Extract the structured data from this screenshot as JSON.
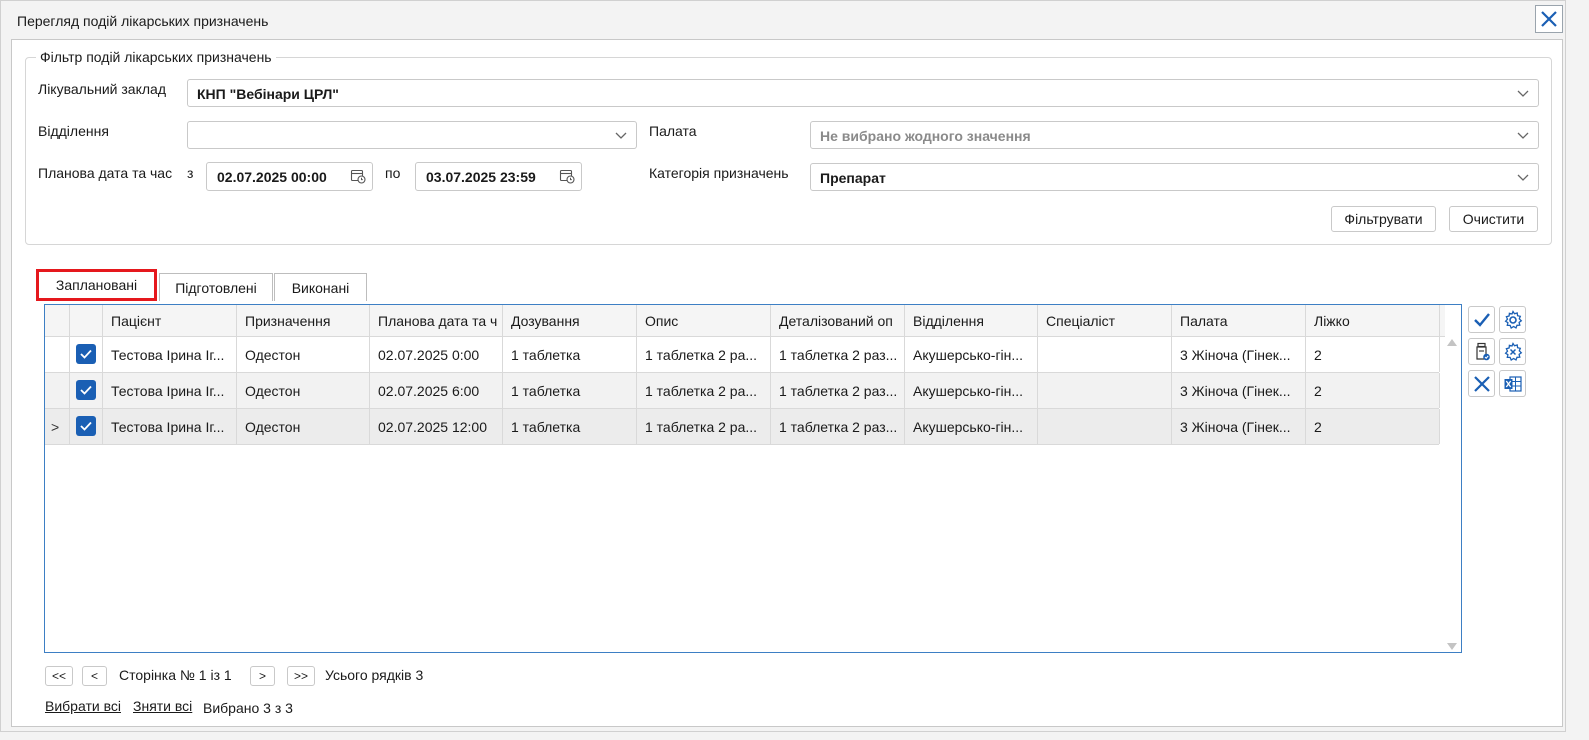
{
  "window": {
    "title": "Перегляд подій лікарських призначень"
  },
  "filter": {
    "legend": "Фільтр подій лікарських призначень",
    "facility_label": "Лікувальний заклад",
    "facility_value": "КНП \"Вебінари ЦРЛ\"",
    "department_label": "Відділення",
    "department_value": "",
    "ward_label": "Палата",
    "ward_placeholder": "Не вибрано жодного значення",
    "date_label": "Планова дата та час",
    "from_label": "з",
    "date_from": "02.07.2025 00:00",
    "to_label": "по",
    "date_to": "03.07.2025 23:59",
    "category_label": "Категорія призначень",
    "category_value": "Препарат",
    "filter_button": "Фільтрувати",
    "clear_button": "Очистити"
  },
  "tabs": [
    {
      "label": "Заплановані",
      "active": true
    },
    {
      "label": "Підготовлені",
      "active": false
    },
    {
      "label": "Виконані",
      "active": false
    }
  ],
  "grid": {
    "columns": [
      "Пацієнт",
      "Призначення",
      "Планова дата та ч",
      "Дозування",
      "Опис",
      "Деталізований оп",
      "Відділення",
      "Спеціаліст",
      "Палата",
      "Ліжко"
    ],
    "rows": [
      {
        "patient": "Тестова Ірина Іг...",
        "prescription": "Одестон",
        "date": "02.07.2025 0:00",
        "dosage": "1 таблетка",
        "description": "1 таблетка 2 ра...",
        "detailed": "1 таблетка 2 раз...",
        "department": "Акушерсько-гін...",
        "specialist": "",
        "ward": "3 Жіноча (Гінек...",
        "bed": "2",
        "checked": true,
        "current": false
      },
      {
        "patient": "Тестова Ірина Іг...",
        "prescription": "Одестон",
        "date": "02.07.2025 6:00",
        "dosage": "1 таблетка",
        "description": "1 таблетка 2 ра...",
        "detailed": "1 таблетка 2 раз...",
        "department": "Акушерсько-гін...",
        "specialist": "",
        "ward": "3 Жіноча (Гінек...",
        "bed": "2",
        "checked": true,
        "current": false
      },
      {
        "patient": "Тестова Ірина Іг...",
        "prescription": "Одестон",
        "date": "02.07.2025 12:00",
        "dosage": "1 таблетка",
        "description": "1 таблетка 2 ра...",
        "detailed": "1 таблетка 2 раз...",
        "department": "Акушерсько-гін...",
        "specialist": "",
        "ward": "3 Жіноча (Гінек...",
        "bed": "2",
        "checked": true,
        "current": true
      }
    ],
    "current_row_marker": ">"
  },
  "pager": {
    "first": "<<",
    "prev": "<",
    "page_text": "Сторінка № 1 із 1",
    "next": ">",
    "last": ">>",
    "total_text": "Усього рядків 3"
  },
  "selection": {
    "select_all": "Вибрати всі",
    "deselect_all": "Зняти всі",
    "selected_text": "Вибрано 3 з 3"
  },
  "colors": {
    "accent": "#1a5fb4",
    "tab_highlight": "#e5181d",
    "grid_border": "#3d7fc4"
  }
}
